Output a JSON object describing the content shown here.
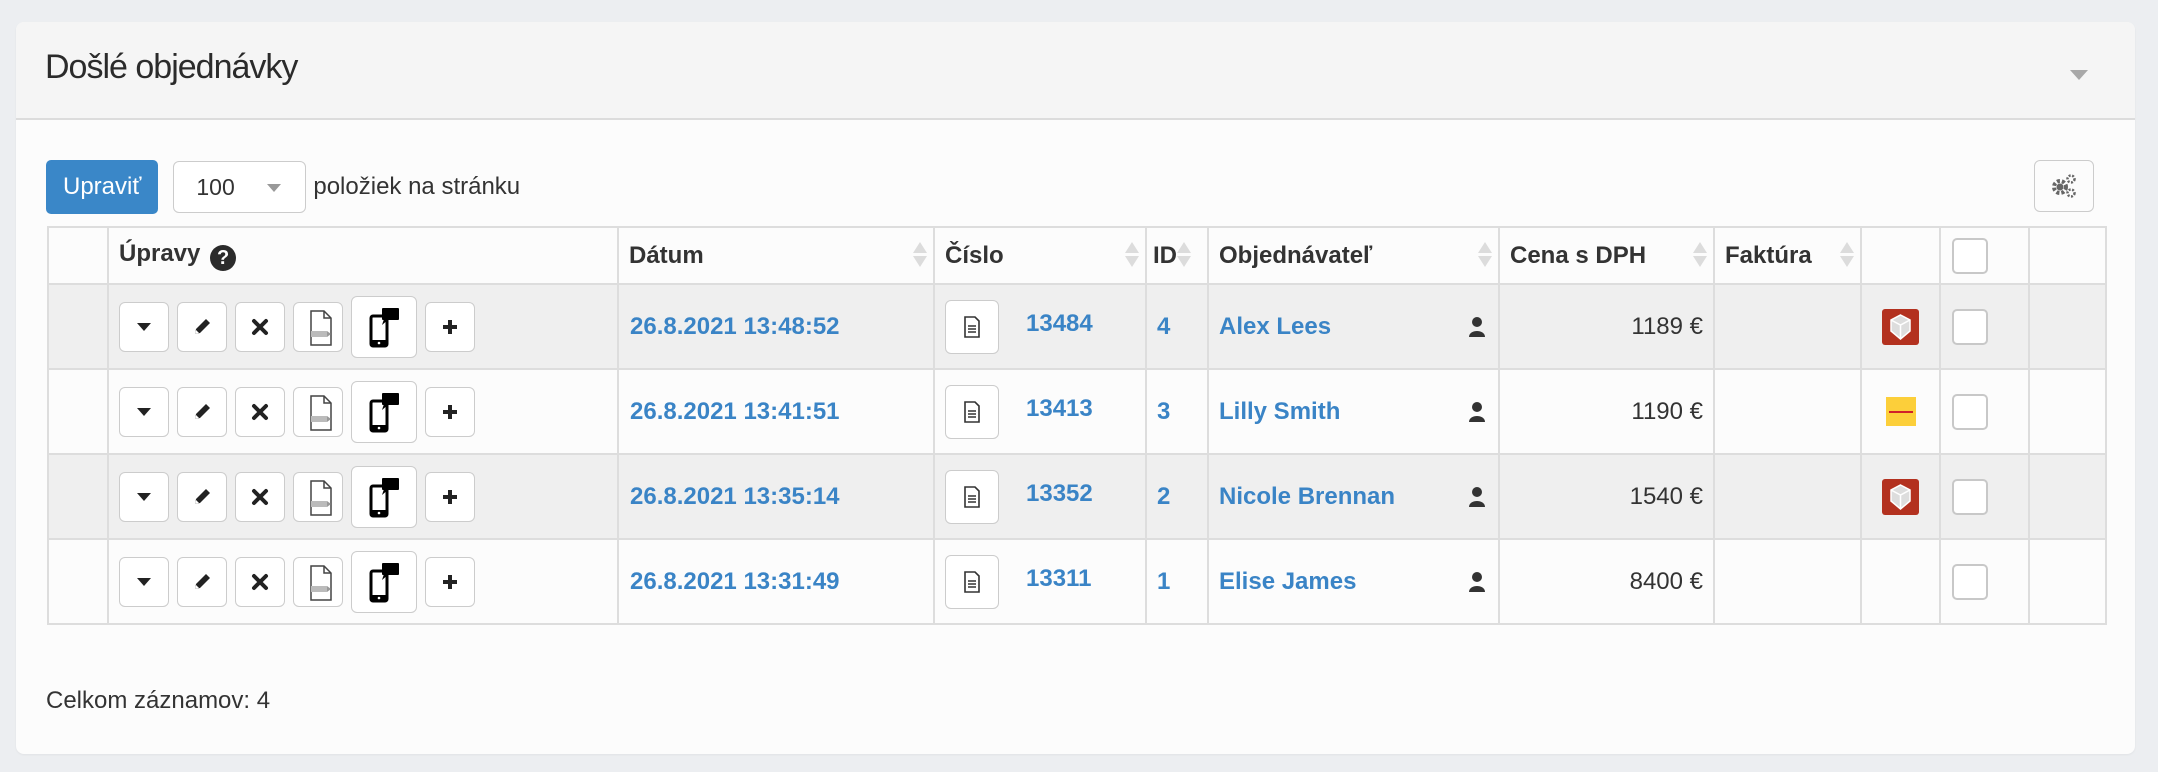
{
  "panel": {
    "title": "Došlé objednávky",
    "collapse_icon": "caret-down-icon"
  },
  "toolbar": {
    "edit_label": "Upraviť",
    "per_page_value": "100",
    "per_page_label": "položiek na stránku",
    "settings_icon": "gears-icon"
  },
  "table": {
    "headers": {
      "actions": "Úpravy",
      "date": "Dátum",
      "number": "Číslo",
      "id": "ID",
      "customer": "Objednávateľ",
      "price": "Cena s DPH",
      "invoice": "Faktúra"
    },
    "action_icons": [
      "caret-down-icon",
      "pencil-icon",
      "close-icon",
      "export-file-icon",
      "mobile-message-icon",
      "plus-icon"
    ],
    "rows": [
      {
        "date": "26.8.2021 13:48:52",
        "number": "13484",
        "id": "4",
        "customer": "Alex Lees",
        "price": "1189 €",
        "invoice": "",
        "carrier": "dpd",
        "checked": false
      },
      {
        "date": "26.8.2021 13:41:51",
        "number": "13413",
        "id": "3",
        "customer": "Lilly Smith",
        "price": "1190 €",
        "invoice": "",
        "carrier": "dhl",
        "checked": false
      },
      {
        "date": "26.8.2021 13:35:14",
        "number": "13352",
        "id": "2",
        "customer": "Nicole Brennan",
        "price": "1540 €",
        "invoice": "",
        "carrier": "dpd",
        "checked": false
      },
      {
        "date": "26.8.2021 13:31:49",
        "number": "13311",
        "id": "1",
        "customer": "Elise James",
        "price": "8400 €",
        "invoice": "",
        "carrier": "",
        "checked": false
      }
    ]
  },
  "footer": {
    "total_label": "Celkom záznamov: 4"
  },
  "colors": {
    "primary": "#3a87c8",
    "link": "#3a84c6",
    "row_stripe": "#efefef",
    "dpd": "#b3311f",
    "dhl": "#fccf3a"
  }
}
